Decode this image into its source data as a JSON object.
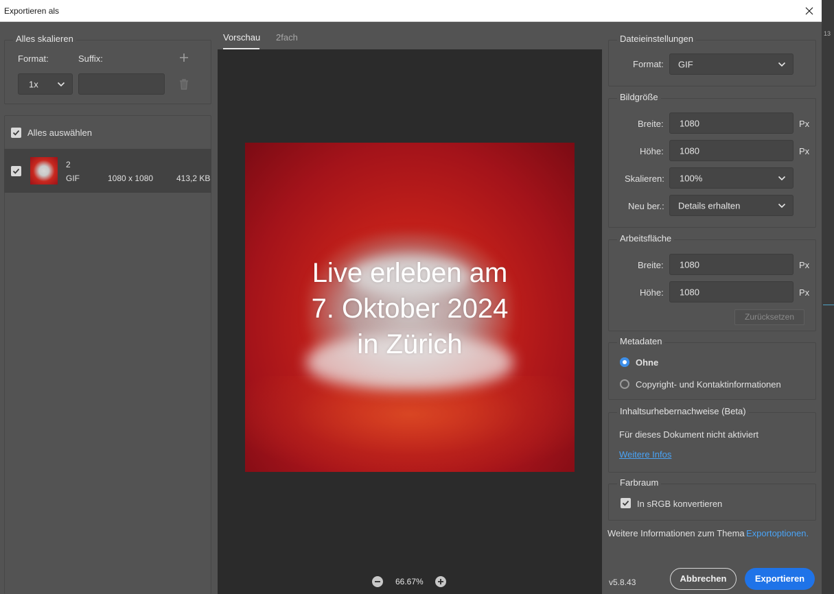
{
  "window": {
    "title": "Exportieren als"
  },
  "scale_all": {
    "title": "Alles skalieren",
    "format_label": "Format:",
    "suffix_label": "Suffix:",
    "scale_value": "1x",
    "suffix_value": ""
  },
  "assets": {
    "select_all_label": "Alles auswählen",
    "items": [
      {
        "name": "2",
        "format": "GIF",
        "dimensions": "1080 x 1080",
        "size": "413,2 KB"
      }
    ]
  },
  "preview": {
    "tabs": [
      {
        "label": "Vorschau"
      },
      {
        "label": "2fach"
      }
    ],
    "image_text": [
      "Live erleben am",
      "7. Oktober 2024",
      "in Zürich"
    ],
    "zoom": "66.67%"
  },
  "file_settings": {
    "title": "Dateieinstellungen",
    "format_label": "Format:",
    "format_value": "GIF"
  },
  "image_size": {
    "title": "Bildgröße",
    "width_label": "Breite:",
    "width_value": "1080",
    "height_label": "Höhe:",
    "height_value": "1080",
    "unit": "Px",
    "scale_label": "Skalieren:",
    "scale_value": "100%",
    "resample_label": "Neu ber.:",
    "resample_value": "Details erhalten"
  },
  "canvas_size": {
    "title": "Arbeitsfläche",
    "width_label": "Breite:",
    "width_value": "1080",
    "height_label": "Höhe:",
    "height_value": "1080",
    "unit": "Px",
    "reset_label": "Zurücksetzen"
  },
  "metadata": {
    "title": "Metadaten",
    "option_none": "Ohne",
    "option_copyright": "Copyright- und Kontaktinformationen"
  },
  "content_credentials": {
    "title": "Inhaltsurhebernachweise (Beta)",
    "status": "Für dieses Dokument nicht aktiviert",
    "link": "Weitere Infos"
  },
  "color_space": {
    "title": "Farbraum",
    "convert_label": "In sRGB konvertieren"
  },
  "footer": {
    "info_text": "Weitere Informationen zum Thema",
    "info_link": "Exportoptionen.",
    "version": "v5.8.43",
    "cancel_label": "Abbrechen",
    "export_label": "Exportieren"
  },
  "side_strip": {
    "label": "13"
  },
  "colors": {
    "accent": "#1f73e8",
    "link": "#4aa3f5",
    "panel": "#535353",
    "canvas": "#2b2b2b"
  }
}
